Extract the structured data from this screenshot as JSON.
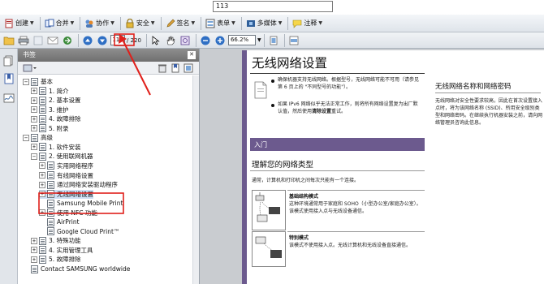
{
  "top": {
    "page_input_value": "113"
  },
  "toolbar1": {
    "items": [
      {
        "label": "创建"
      },
      {
        "label": "合并"
      },
      {
        "label": "协作"
      },
      {
        "label": "安全"
      },
      {
        "label": "签名"
      },
      {
        "label": "表单"
      },
      {
        "label": "多媒体"
      },
      {
        "label": "注释"
      }
    ]
  },
  "toolbar2": {
    "page_current": "112",
    "page_total": "/ 220",
    "zoom": "66.2%"
  },
  "panel": {
    "title": "书签",
    "items": [
      {
        "label": "基本",
        "level": 0,
        "exp": "⊟"
      },
      {
        "label": "1. 简介",
        "level": 1,
        "exp": "⊞"
      },
      {
        "label": "2. 基本设置",
        "level": 1,
        "exp": "⊞"
      },
      {
        "label": "3. 维护",
        "level": 1,
        "exp": "⊞"
      },
      {
        "label": "4. 故障排除",
        "level": 1,
        "exp": "⊞"
      },
      {
        "label": "5. 附录",
        "level": 1,
        "exp": "⊞"
      },
      {
        "label": "高级",
        "level": 0,
        "exp": "⊟"
      },
      {
        "label": "1. 软件安装",
        "level": 1,
        "exp": "⊞"
      },
      {
        "label": "2. 使用联网机器",
        "level": 1,
        "exp": "⊟"
      },
      {
        "label": "实用网络程序",
        "level": 2,
        "exp": "⊞"
      },
      {
        "label": "有线网络设置",
        "level": 2,
        "exp": "⊞"
      },
      {
        "label": "通过网络安装驱动程序",
        "level": 2,
        "exp": "⊞"
      },
      {
        "label": "无线网络设置",
        "level": 2,
        "exp": "⊞"
      },
      {
        "label": "Samsung Mobile Print",
        "level": 2,
        "exp": ""
      },
      {
        "label": "使用 NFC 功能",
        "level": 2,
        "exp": "⊞"
      },
      {
        "label": "AirPrint",
        "level": 2,
        "exp": ""
      },
      {
        "label": "Google Cloud Print™",
        "level": 2,
        "exp": ""
      },
      {
        "label": "3. 特殊功能",
        "level": 1,
        "exp": "⊞"
      },
      {
        "label": "4. 实用管理工具",
        "level": 1,
        "exp": "⊞"
      },
      {
        "label": "5. 故障排除",
        "level": 1,
        "exp": "⊞"
      },
      {
        "label": "Contact SAMSUNG worldwide",
        "level": 0,
        "exp": ""
      }
    ]
  },
  "doc": {
    "title": "无线网络设置",
    "note1": "确保机器支持无线网络。根据型号，无线网络可能不可用（请参见第 6 页上的 \"不同型号的功能\"）。",
    "note2_pre": "如果 IPv6 网络似乎无法正常工作，则将所有网络设置复为出厂默认值，然后使用",
    "note2_bold": "清除设置",
    "note2_post": "重试。",
    "section_bar": "入门",
    "subheading": "理解您的网络类型",
    "intro": "通常，计算机和打印机之间每次只能有一个连接。",
    "mode1_title": "基础结构模式",
    "mode1_text": "这种环境通常用于家庭和 SOHO（小型办公室/家庭办公室）。该模式使用接入点与无线设备通信。",
    "mode2_title": "特别模式",
    "mode2_text": "该模式不使用接入点。无线计算机和无线设备直接通信。",
    "right_heading": "无线网络名称和网络密码",
    "right_text": "无线网络对安全性要求较高，因此在首次设置接入点时，将为该网络名称 (SSID)、所用安全级别类型和网络密码。在继续执行机器安装之前，请向网络管理员咨询此信息。"
  },
  "colors": {
    "purple": "#6c5a8e",
    "annotation_red": "#e0201b",
    "selection": "#cfe0f5"
  }
}
